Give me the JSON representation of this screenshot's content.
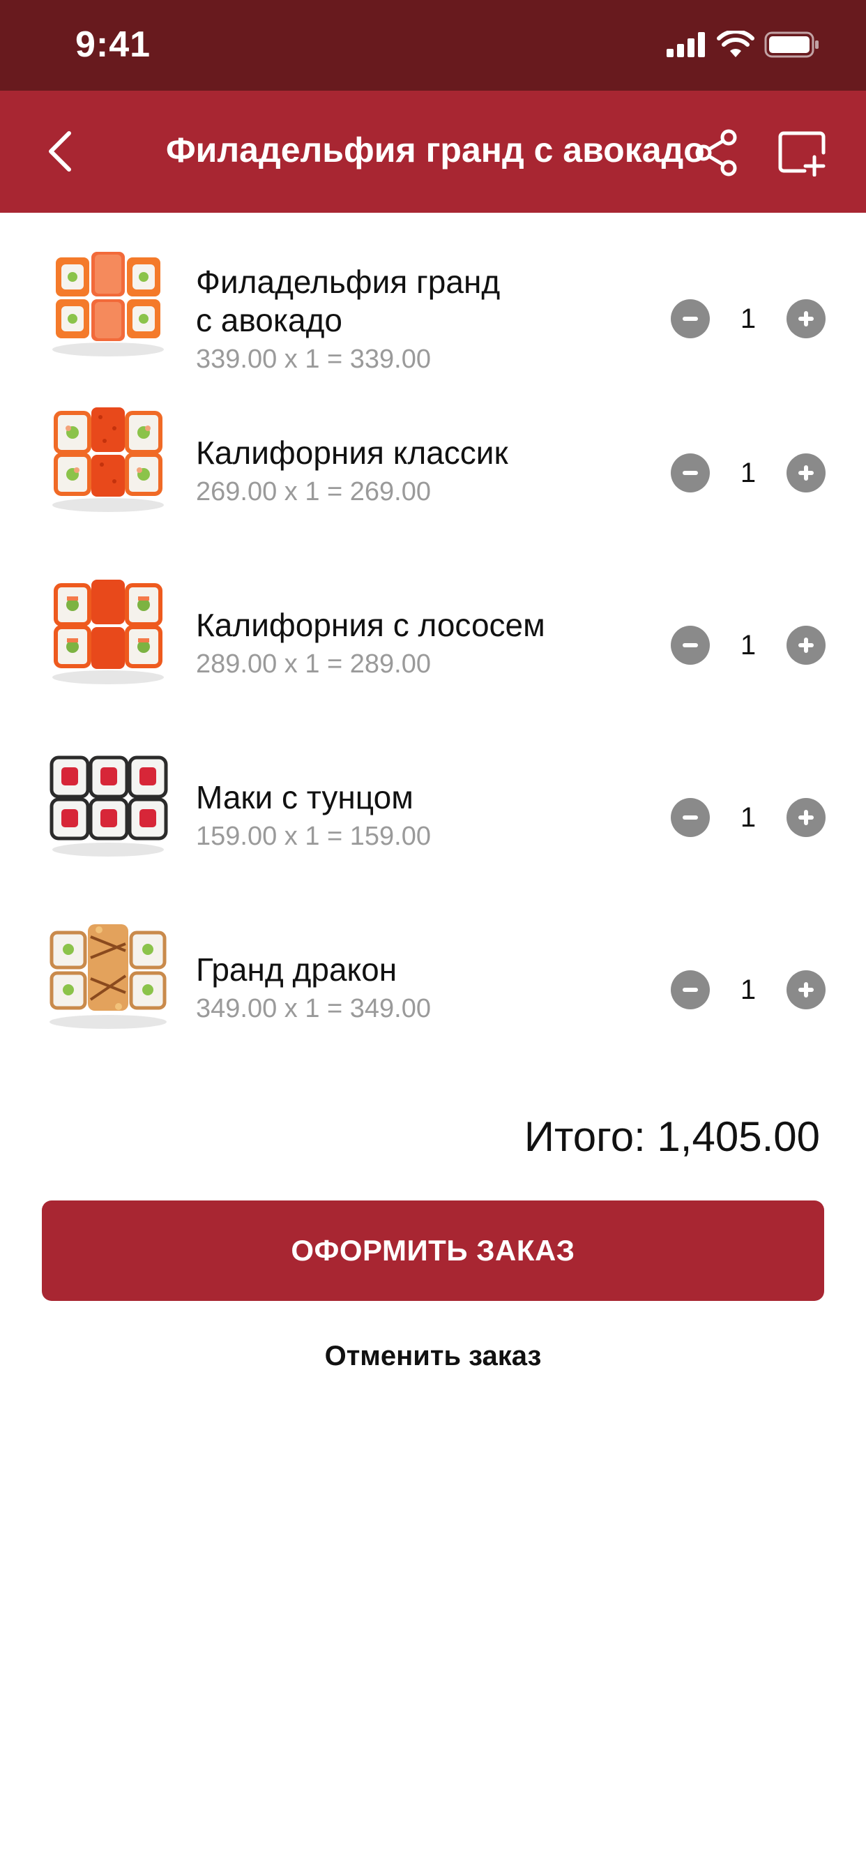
{
  "status": {
    "time": "9:41"
  },
  "header": {
    "title": "Филадельфия гранд с авокадо"
  },
  "items": [
    {
      "name_line1": "Филадельфия гранд",
      "name_line2": "с авокадо",
      "calc": "339.00 x 1 = 339.00",
      "qty": "1"
    },
    {
      "name_line1": "Калифорния классик",
      "name_line2": "",
      "calc": "269.00 x 1 = 269.00",
      "qty": "1"
    },
    {
      "name_line1": "Калифорния с лососем",
      "name_line2": "",
      "calc": "289.00 x 1 = 289.00",
      "qty": "1"
    },
    {
      "name_line1": "Маки с тунцом",
      "name_line2": "",
      "calc": "159.00 x 1 = 159.00",
      "qty": "1"
    },
    {
      "name_line1": "Гранд дракон",
      "name_line2": "",
      "calc": "349.00 x 1 = 349.00",
      "qty": "1"
    }
  ],
  "summary": {
    "total": "Итого: 1,405.00"
  },
  "actions": {
    "order_label": "ОФОРМИТЬ ЗАКАЗ",
    "cancel_label": "Отменить заказ"
  },
  "icons": {
    "back": "chevron-left-icon",
    "share": "share-icon",
    "add": "add-to-collection-icon",
    "minus": "minus-circle-icon",
    "plus": "plus-circle-icon"
  },
  "colors": {
    "status_bar": "#681A1E",
    "primary": "#A82632",
    "secondary_text": "#9a9a9a",
    "qty_button": "#8a8a8a"
  }
}
